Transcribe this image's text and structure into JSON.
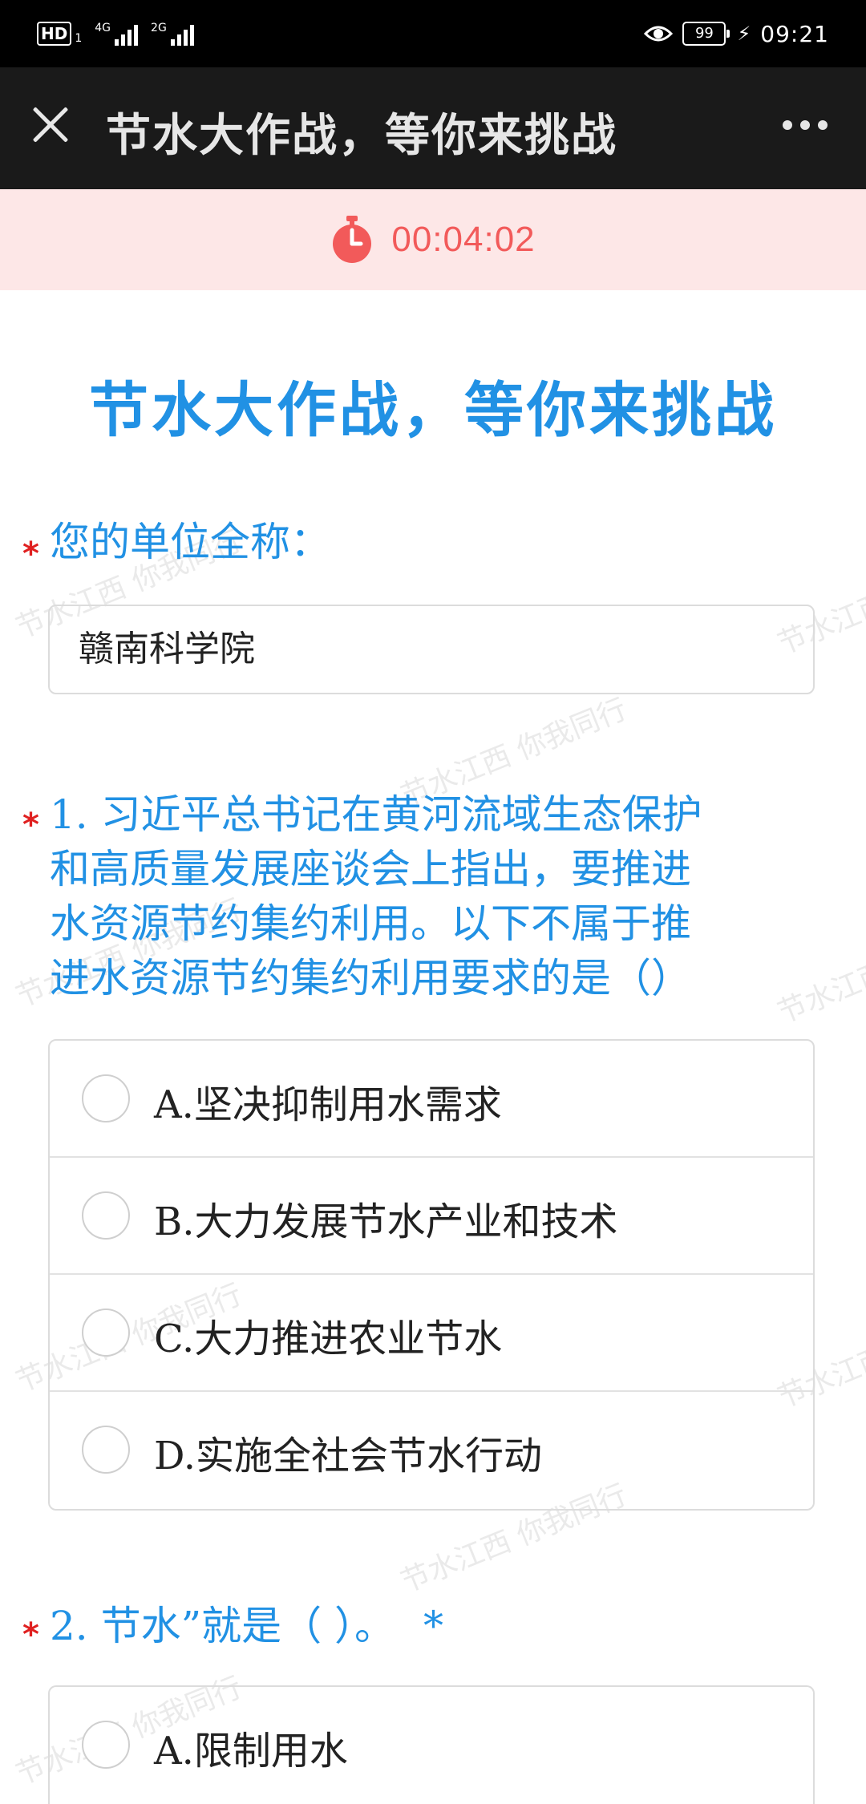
{
  "status_bar": {
    "hd": "HD",
    "sim": "1",
    "network1": "4G",
    "network2": "2G",
    "battery": "99",
    "time": "09:21"
  },
  "title_bar": {
    "title": "节水大作战，等你来挑战"
  },
  "timer": {
    "value": "00:04:02",
    "color": "#f25a5a"
  },
  "watermark": "节水江西 你我同行",
  "form": {
    "heading": "节水大作战，等你来挑战",
    "accent_color": "#2191e4",
    "unit_question": {
      "label": "您的单位全称：",
      "value": "赣南科学院"
    },
    "q1": {
      "lines": [
        "1. 习近平总书记在黄河流域生态保护",
        "和高质量发展座谈会上指出，要推进",
        "水资源节约集约利用。以下不属于推",
        "进水资源节约集约利用要求的是（）"
      ],
      "options": [
        "A.坚决抑制用水需求",
        "B.大力发展节水产业和技术",
        "C.大力推进农业节水",
        "D.实施全社会节水行动"
      ]
    },
    "q2": {
      "label": "2. 节水”就是（ ）。",
      "inline_star": "*",
      "options": [
        "A.限制用水"
      ]
    }
  }
}
